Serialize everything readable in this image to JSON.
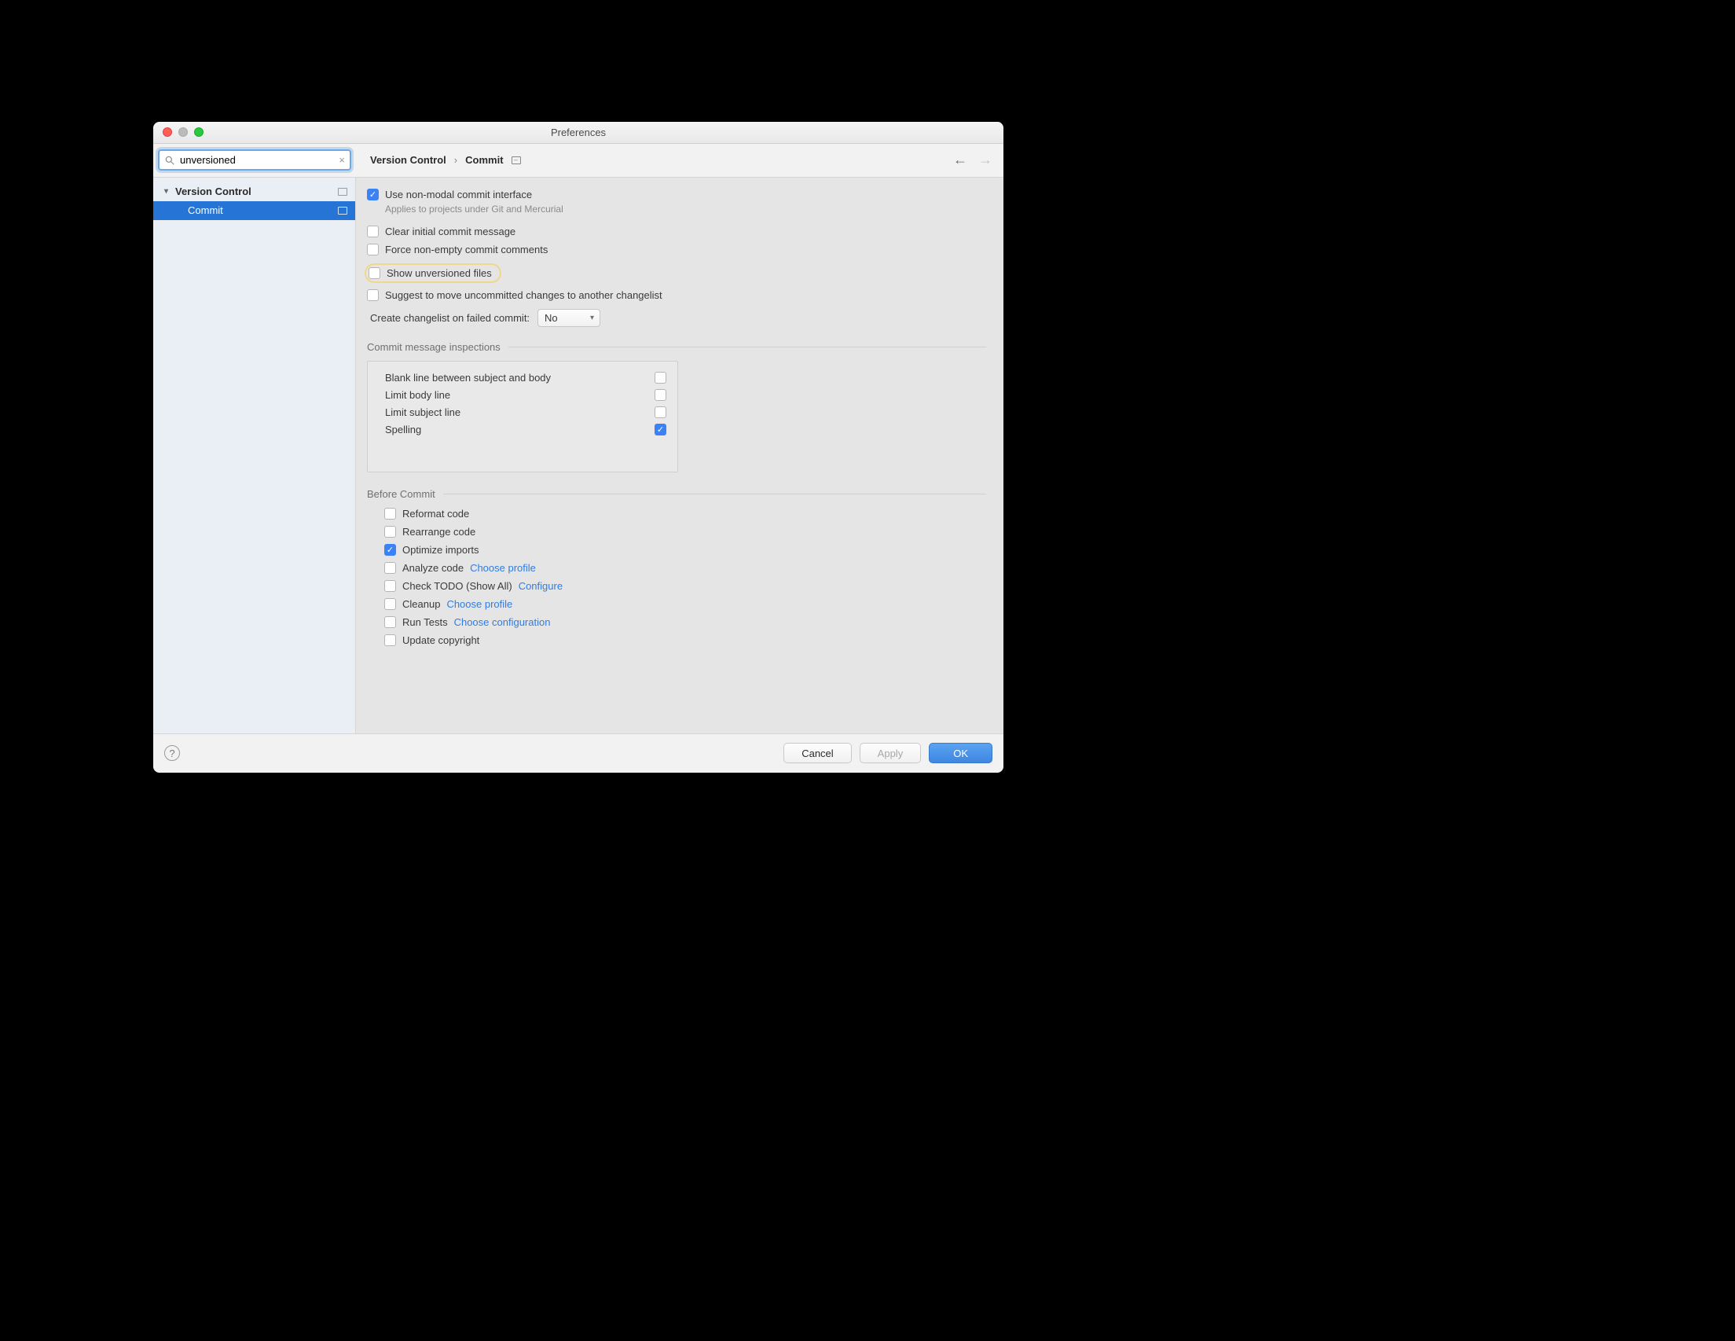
{
  "window": {
    "title": "Preferences"
  },
  "search": {
    "value": "unversioned",
    "placeholder": ""
  },
  "sidebar": {
    "parent": "Version Control",
    "child": "Commit"
  },
  "breadcrumb": {
    "a": "Version Control",
    "b": "Commit"
  },
  "options": {
    "nonmodal": {
      "label": "Use non-modal commit interface",
      "help": "Applies to projects under Git and Mercurial"
    },
    "clear": "Clear initial commit message",
    "force": "Force non-empty commit comments",
    "unversioned": "Show unversioned files",
    "suggest": "Suggest to move uncommitted changes to another changelist",
    "changelist_label": "Create changelist on failed commit:",
    "changelist_value": "No"
  },
  "inspections": {
    "title": "Commit message inspections",
    "rows": {
      "blank": "Blank line between subject and body",
      "body": "Limit body line",
      "subject": "Limit subject line",
      "spelling": "Spelling"
    }
  },
  "before": {
    "title": "Before Commit",
    "reformat": "Reformat code",
    "rearrange": "Rearrange code",
    "optimize": "Optimize imports",
    "analyze": "Analyze code",
    "analyze_link": "Choose profile",
    "todo": "Check TODO (Show All)",
    "todo_link": "Configure",
    "cleanup": "Cleanup",
    "cleanup_link": "Choose profile",
    "tests": "Run Tests",
    "tests_link": "Choose configuration",
    "copyright": "Update copyright"
  },
  "footer": {
    "cancel": "Cancel",
    "apply": "Apply",
    "ok": "OK"
  }
}
